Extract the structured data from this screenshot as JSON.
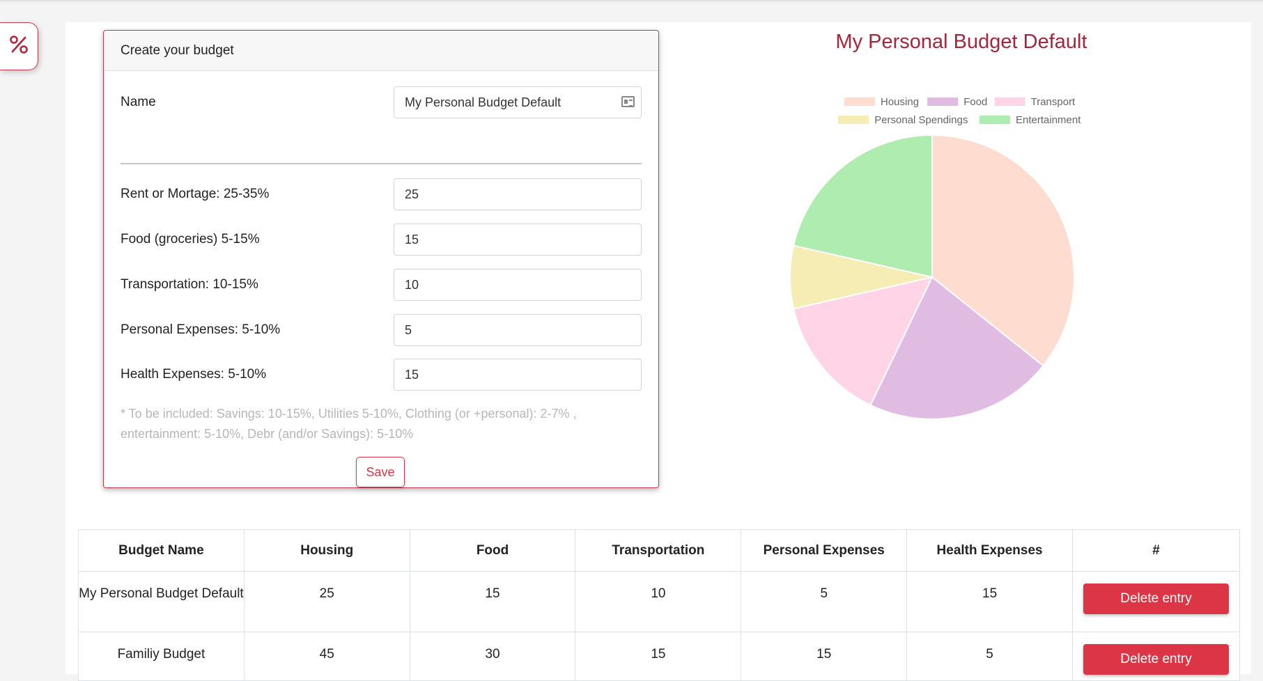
{
  "fab": {
    "icon": "percent-icon",
    "glyph": "%"
  },
  "form": {
    "header": "Create your budget",
    "name_label": "Name",
    "name_value": "My Personal Budget Default",
    "fields": [
      {
        "label": "Rent or Mortage: 25-35%",
        "value": "25"
      },
      {
        "label": "Food (groceries) 5-15%",
        "value": "15"
      },
      {
        "label": "Transportation: 10-15%",
        "value": "10"
      },
      {
        "label": "Personal Expenses: 5-10%",
        "value": "5"
      },
      {
        "label": "Health Expenses: 5-10%",
        "value": "15"
      }
    ],
    "note_line1": "* To be included: Savings: 10-15%, Utilities 5-10%, Clothing (or +personal): 2-7% ,",
    "note_line2": "entertainment: 5-10%, Debr (and/or Savings): 5-10%",
    "save_label": "Save"
  },
  "chart_data": {
    "type": "pie",
    "title": "My Personal Budget Default",
    "categories": [
      "Housing",
      "Food",
      "Transport",
      "Personal Spendings",
      "Entertainment"
    ],
    "values": [
      25,
      15,
      10,
      5,
      15
    ],
    "colors": [
      "#ffdcd0",
      "#e0bce3",
      "#ffd4e6",
      "#f5edb4",
      "#aeecaf"
    ],
    "legend_position": "top"
  },
  "table": {
    "headers": [
      "Budget Name",
      "Housing",
      "Food",
      "Transportation",
      "Personal Expenses",
      "Health Expenses",
      "#"
    ],
    "rows": [
      {
        "name": "My Personal Budget Default",
        "values": [
          "25",
          "15",
          "10",
          "5",
          "15"
        ],
        "action": "Delete entry"
      },
      {
        "name": "Familiy Budget",
        "values": [
          "45",
          "30",
          "15",
          "15",
          "5"
        ],
        "action": "Delete entry"
      }
    ]
  }
}
